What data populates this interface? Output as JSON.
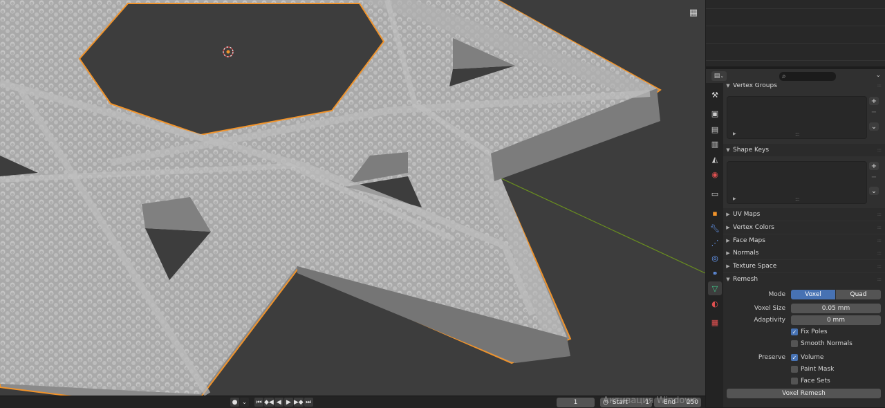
{
  "viewport": {
    "grid_icon": "grid-icon",
    "colors": {
      "background": "#3d3d3d",
      "selection_outline": "#f0932b",
      "axis_x": "#b5424f",
      "axis_y": "#6a8f1f",
      "mesh": "#9b9b9b"
    }
  },
  "timeline": {
    "controls": [
      "●",
      "⏮",
      "◆◀",
      "◀",
      "▶",
      "▶◆",
      "⏭"
    ],
    "current_frame": "1",
    "start_label": "Start",
    "start_value": "1",
    "end_label": "End",
    "end_value": "250"
  },
  "watermark": "Активация Windows",
  "properties": {
    "search_placeholder": "",
    "tabs": [
      "tool-icon",
      "render-icon",
      "output-icon",
      "view-layer-icon",
      "scene-icon",
      "world-icon",
      "collection-icon",
      "object-icon",
      "modifier-icon",
      "particles-icon",
      "physics-icon",
      "constraints-icon",
      "data-icon",
      "material-icon",
      "texture-icon"
    ],
    "panels": {
      "vertex_groups": "Vertex Groups",
      "shape_keys": "Shape Keys",
      "uv_maps": "UV Maps",
      "vertex_colors": "Vertex Colors",
      "face_maps": "Face Maps",
      "normals": "Normals",
      "texture_space": "Texture Space",
      "remesh": "Remesh"
    },
    "remesh": {
      "mode_label": "Mode",
      "mode_voxel": "Voxel",
      "mode_quad": "Quad",
      "voxel_size_label": "Voxel Size",
      "voxel_size_value": "0.05 mm",
      "adaptivity_label": "Adaptivity",
      "adaptivity_value": "0 mm",
      "fix_poles": "Fix Poles",
      "smooth_normals": "Smooth Normals",
      "preserve_label": "Preserve",
      "volume": "Volume",
      "paint_mask": "Paint Mask",
      "face_sets": "Face Sets",
      "voxel_remesh_button": "Voxel Remesh"
    },
    "accent": "#4772b3"
  }
}
